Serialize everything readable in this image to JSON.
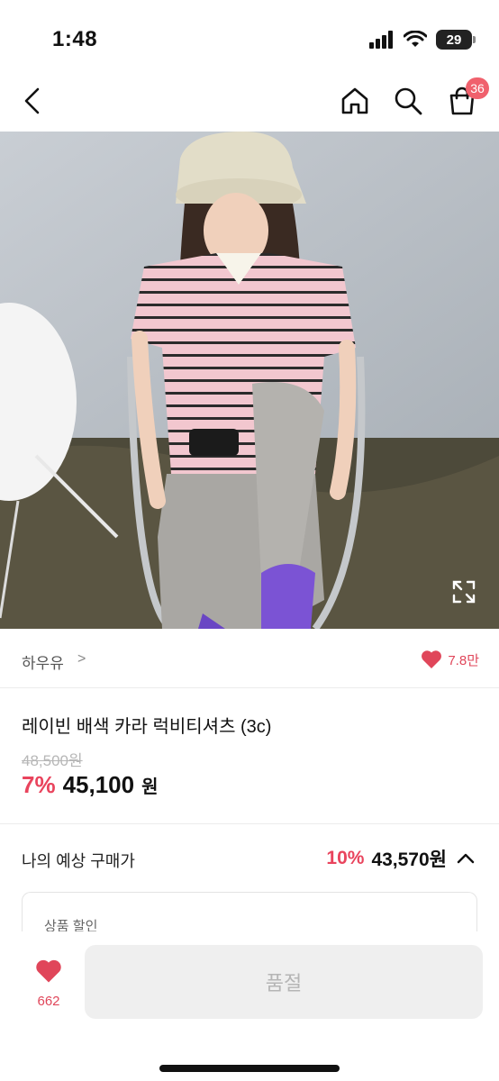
{
  "status_bar": {
    "time": "1:48",
    "battery": "29"
  },
  "nav": {
    "cart_badge": "36"
  },
  "shop": {
    "name": "하우유",
    "chevron": ">",
    "like_count": "7.8만"
  },
  "product": {
    "title": "레이빈 배색 카라 럭비티셔츠 (3c)",
    "original_price": "48,500원",
    "discount_rate": "7%",
    "price": "45,100",
    "currency": "원"
  },
  "expected_price": {
    "label": "나의 예상 구매가",
    "discount_rate": "10%",
    "price": "43,570원"
  },
  "detail_box": {
    "label": "상품 할인"
  },
  "bottom_bar": {
    "wish_count": "662",
    "soldout_label": "품절"
  },
  "colors": {
    "accent": "#e9445d",
    "heart": "#e0465a",
    "badge": "#f0616d",
    "disabled_button": "#efefef"
  },
  "icons": [
    "back-arrow-icon",
    "home-icon",
    "search-icon",
    "cart-icon",
    "heart-icon",
    "expand-icon",
    "chevron-up-icon",
    "signal-icon",
    "wifi-icon",
    "battery-icon"
  ]
}
